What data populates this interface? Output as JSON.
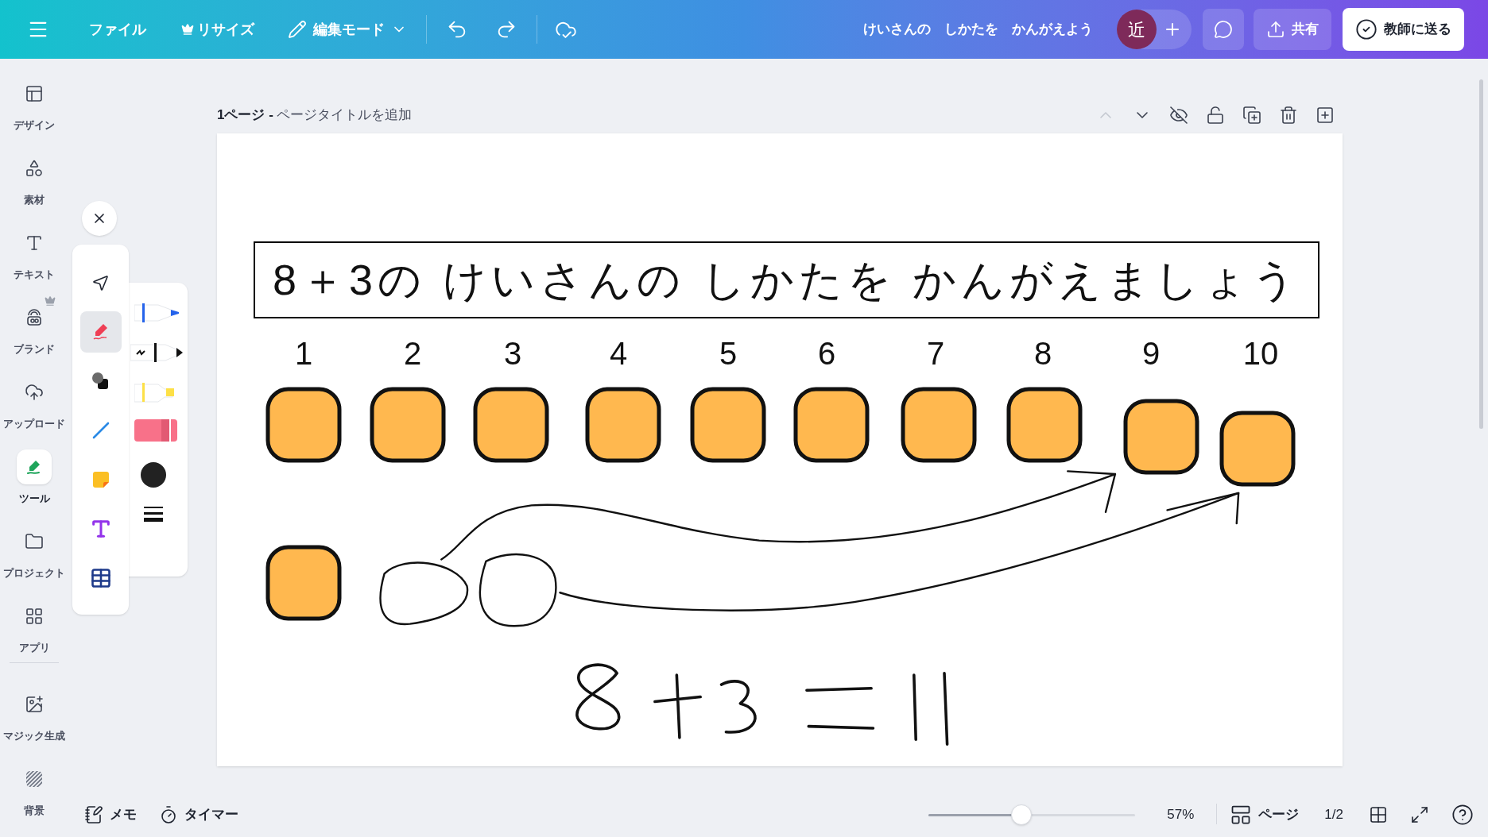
{
  "topbar": {
    "menu_items": [
      {
        "label": "ファイル"
      },
      {
        "label": "リサイズ"
      },
      {
        "label": "編集モード"
      }
    ],
    "doc_title": "けいさんの　しかたを　かんがえよう",
    "avatar": "近",
    "share": "共有",
    "send": "教師に送る"
  },
  "sidebar": [
    {
      "label": "デザイン",
      "selected": false,
      "premium": false
    },
    {
      "label": "素材",
      "selected": false,
      "premium": false
    },
    {
      "label": "テキスト",
      "selected": false,
      "premium": false
    },
    {
      "label": "ブランド",
      "selected": false,
      "premium": true
    },
    {
      "label": "アップロード",
      "selected": false,
      "premium": false
    },
    {
      "label": "ツール",
      "selected": true,
      "premium": false
    },
    {
      "label": "プロジェクト",
      "selected": false,
      "premium": false
    },
    {
      "label": "アプリ",
      "selected": false,
      "premium": false
    },
    {
      "label": "マジック生成",
      "selected": false,
      "premium": false
    },
    {
      "label": "背景",
      "selected": false,
      "premium": false
    }
  ],
  "page_header": {
    "page_label": "1ページ -",
    "title_placeholder": "ページタイトルを追加"
  },
  "canvas": {
    "heading": "8＋3の けいさんの しかたを かんがえましょう",
    "numbers": [
      "1",
      "2",
      "3",
      "4",
      "5",
      "6",
      "7",
      "8",
      "9",
      "10"
    ]
  },
  "tools": [
    {
      "kind": "select",
      "selected": false
    },
    {
      "kind": "draw",
      "selected": true
    },
    {
      "kind": "shapes",
      "selected": false
    },
    {
      "kind": "line",
      "selected": false
    },
    {
      "kind": "sticky",
      "selected": false
    },
    {
      "kind": "text",
      "selected": false
    },
    {
      "kind": "table",
      "selected": false
    }
  ],
  "bottom": {
    "notes": "メモ",
    "timer": "タイマー",
    "zoom": {
      "level": 0.45
    },
    "zoom_reading": "57%",
    "pages": "ページ",
    "page_count": "1/2"
  }
}
